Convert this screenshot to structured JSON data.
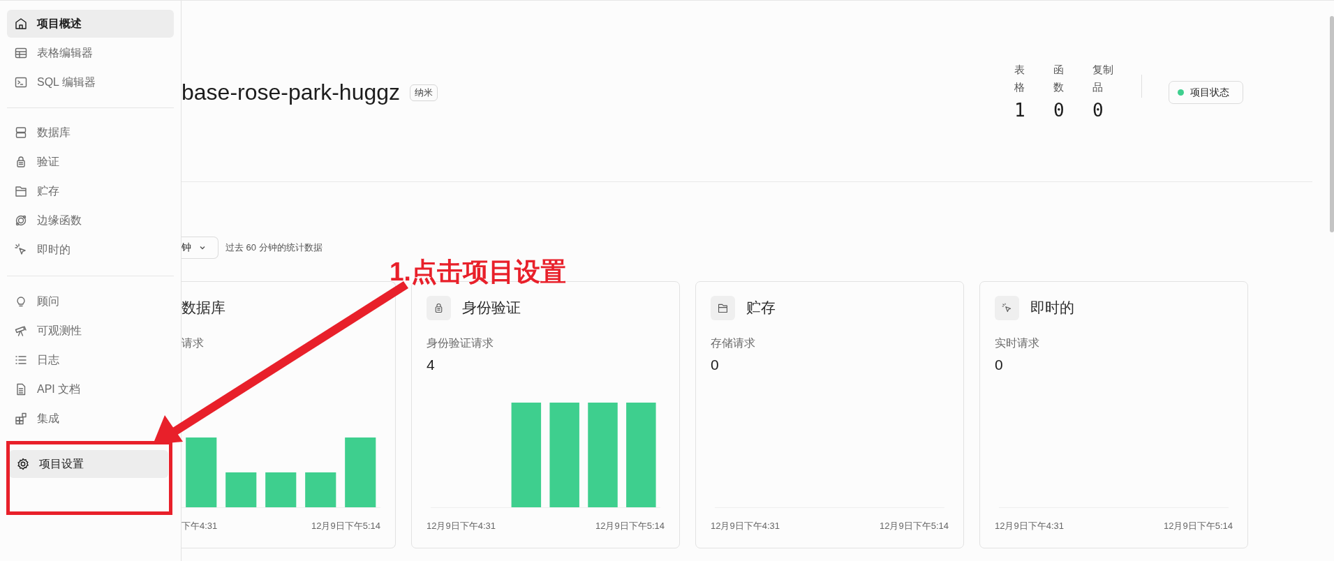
{
  "sidebar": {
    "groups": [
      {
        "items": [
          {
            "label": "项目概述",
            "selected": true,
            "hovered": false
          },
          {
            "label": "表格编辑器",
            "selected": false,
            "hovered": false
          },
          {
            "label": "SQL 编辑器",
            "selected": false,
            "hovered": false
          }
        ]
      },
      {
        "items": [
          {
            "label": "数据库",
            "selected": false,
            "hovered": false
          },
          {
            "label": "验证",
            "selected": false,
            "hovered": false
          },
          {
            "label": "贮存",
            "selected": false,
            "hovered": false
          },
          {
            "label": "边缘函数",
            "selected": false,
            "hovered": false
          },
          {
            "label": "即时的",
            "selected": false,
            "hovered": false
          }
        ]
      },
      {
        "items": [
          {
            "label": "顾问",
            "selected": false,
            "hovered": false
          },
          {
            "label": "可观测性",
            "selected": false,
            "hovered": false
          },
          {
            "label": "日志",
            "selected": false,
            "hovered": false
          },
          {
            "label": "API 文档",
            "selected": false,
            "hovered": false
          },
          {
            "label": "集成",
            "selected": false,
            "hovered": false
          }
        ]
      },
      {
        "items": [
          {
            "label": "项目设置",
            "selected": false,
            "hovered": true
          }
        ]
      }
    ]
  },
  "project": {
    "name": "base-rose-park-huggz",
    "badge": "纳米"
  },
  "stats": [
    {
      "label": "表格",
      "value": "1"
    },
    {
      "label": "函数",
      "value": "0"
    },
    {
      "label": "复制品",
      "value": "0"
    }
  ],
  "status_button": {
    "label": "项目状态"
  },
  "period": {
    "select": "钟",
    "caption": "过去 60 分钟的统计数据"
  },
  "cards": [
    {
      "title": "数据库",
      "subtitle": "请求",
      "clipped": true,
      "start": "下午4:31",
      "end": "12月9日下午5:14"
    },
    {
      "title": "身份验证",
      "subtitle": "身份验证请求",
      "value": "4",
      "clipped": false,
      "start": "12月9日下午4:31",
      "end": "12月9日下午5:14"
    },
    {
      "title": "贮存",
      "subtitle": "存储请求",
      "value": "0",
      "clipped": false,
      "start": "12月9日下午4:31",
      "end": "12月9日下午5:14"
    },
    {
      "title": "即时的",
      "subtitle": "实时请求",
      "value": "0",
      "clipped": false,
      "start": "12月9日下午4:31",
      "end": "12月9日下午5:14"
    }
  ],
  "annotation": {
    "text": "1.点击项目设置"
  }
}
